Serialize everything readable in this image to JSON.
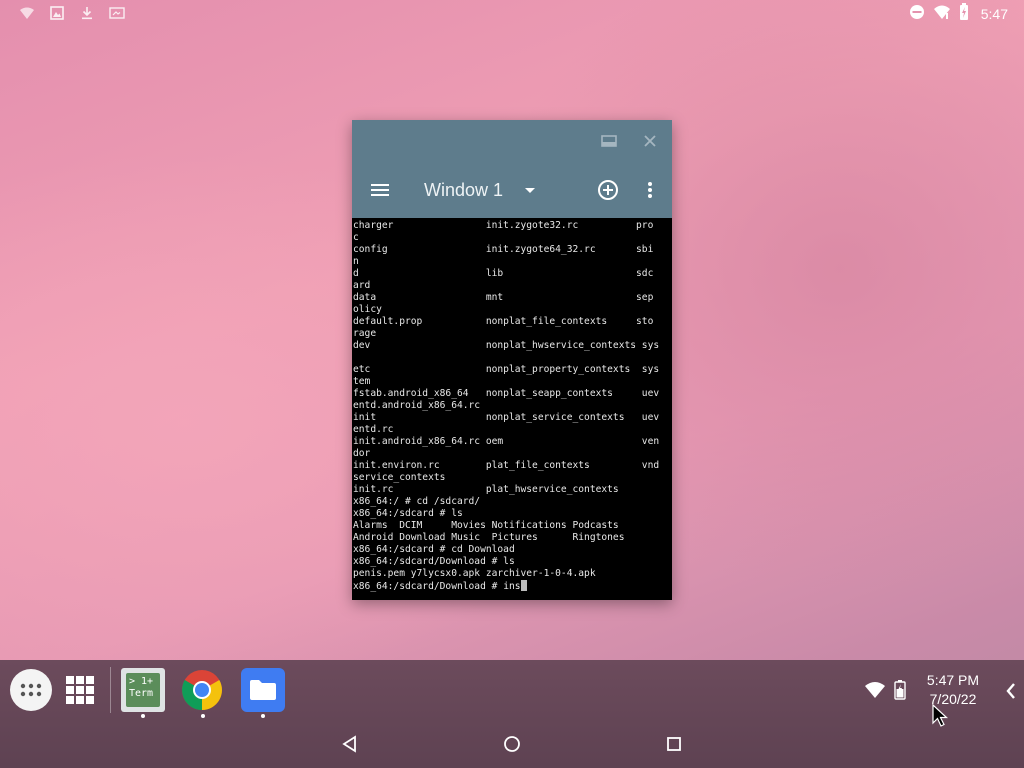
{
  "status_bar": {
    "time": "5:47",
    "left_icons": [
      "signal-icon",
      "photo-icon",
      "download-icon",
      "screenshot-icon"
    ],
    "right_icons": [
      "do-not-disturb-icon",
      "wifi-icon",
      "battery-icon"
    ]
  },
  "window": {
    "caption_buttons": [
      "maximize-icon",
      "close-icon"
    ],
    "toolbar": {
      "title": "Window 1",
      "icons": [
        "menu-icon",
        "dropdown-icon",
        "add-window-icon",
        "more-options-icon"
      ]
    }
  },
  "terminal": {
    "lines": [
      "charger                init.zygote32.rc          pro",
      "c",
      "config                 init.zygote64_32.rc       sbi",
      "n",
      "d                      lib                       sdc",
      "ard",
      "data                   mnt                       sep",
      "olicy",
      "default.prop           nonplat_file_contexts     sto",
      "rage",
      "dev                    nonplat_hwservice_contexts sys",
      "",
      "etc                    nonplat_property_contexts  sys",
      "tem",
      "fstab.android_x86_64   nonplat_seapp_contexts     uev",
      "entd.android_x86_64.rc",
      "init                   nonplat_service_contexts   uev",
      "entd.rc",
      "init.android_x86_64.rc oem                        ven",
      "dor",
      "init.environ.rc        plat_file_contexts         vnd",
      "service_contexts",
      "init.rc                plat_hwservice_contexts",
      "x86_64:/ # cd /sdcard/",
      "x86_64:/sdcard # ls",
      "Alarms  DCIM     Movies Notifications Podcasts",
      "Android Download Music  Pictures      Ringtones",
      "x86_64:/sdcard # cd Download",
      "x86_64:/sdcard/Download # ls",
      "penis.pem y7lycsx0.apk zarchiver-1-0-4.apk"
    ],
    "prompt": "x86_64:/sdcard/Download # ",
    "input": "ins"
  },
  "taskbar": {
    "app_drawer": "apps-icon",
    "recents_grid": "grid-icon",
    "pinned_apps": [
      "terminal-app-icon",
      "chrome-app-icon",
      "files-app-icon"
    ],
    "terminal_icon_text": "> 1+\nTerm",
    "clock_time": "5:47 PM",
    "clock_date": "7/20/22",
    "tray_icons": [
      "wifi-icon",
      "battery-icon",
      "chevron-left-icon"
    ]
  },
  "nav_bar": {
    "buttons": [
      "back-icon",
      "home-icon",
      "recents-icon"
    ]
  }
}
